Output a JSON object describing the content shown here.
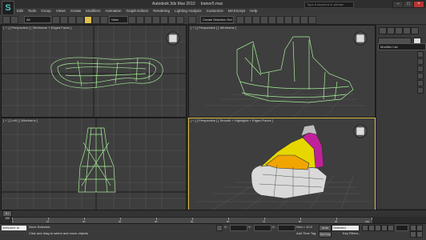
{
  "title_bar": {
    "app_title": "Autodesk 3ds Max 2010",
    "file_name": "trainer5.max",
    "search_placeholder": "Type a keyword or phrase",
    "window_buttons": [
      "minimize-icon",
      "maximize-icon",
      "close-icon"
    ]
  },
  "menu": {
    "items": [
      "Edit",
      "Tools",
      "Group",
      "Views",
      "Create",
      "Modifiers",
      "Animation",
      "Graph Editors",
      "Rendering",
      "Lighting Analysis",
      "Customize",
      "MAXScript",
      "Help"
    ]
  },
  "toolbar": {
    "selection_filter": "All",
    "reference_coord": "View",
    "named_selection": "Create Selection Set"
  },
  "viewports": {
    "top_left_label": "[ + ] [ Perspective ] [ Wireframe + Edged Faces ]",
    "top_right_label": "[ + ] [ Perspective ] [ Wireframe ]",
    "bottom_left_label": "[ + ] [ Left ] [ Wireframe ]",
    "bottom_right_label": "[ + ] [ Perspective ] [ Smooth + Highlights + Edged Faces ]",
    "accent": "#e2c04a",
    "wire_color": "#a8f09a"
  },
  "command_panel": {
    "modifier_list": "Modifier List"
  },
  "timeline": {
    "frame_display": "0 / 100",
    "ticks": [
      "0",
      "10",
      "20",
      "30",
      "40",
      "50",
      "60",
      "70",
      "80",
      "90",
      "100"
    ]
  },
  "status": {
    "welcome": "Welcome to",
    "selection": "None Selected",
    "prompt": "Click and drag to select and move objects",
    "grid": "Grid = 10.0",
    "add_time_tag": "Add Time Tag",
    "auto_key": "Auto Key",
    "set_key": "Set Key",
    "selected_mode": "Selected",
    "key_filters": "Key Filters...",
    "x_label": "X:",
    "y_label": "Y:",
    "z_label": "Z:"
  }
}
